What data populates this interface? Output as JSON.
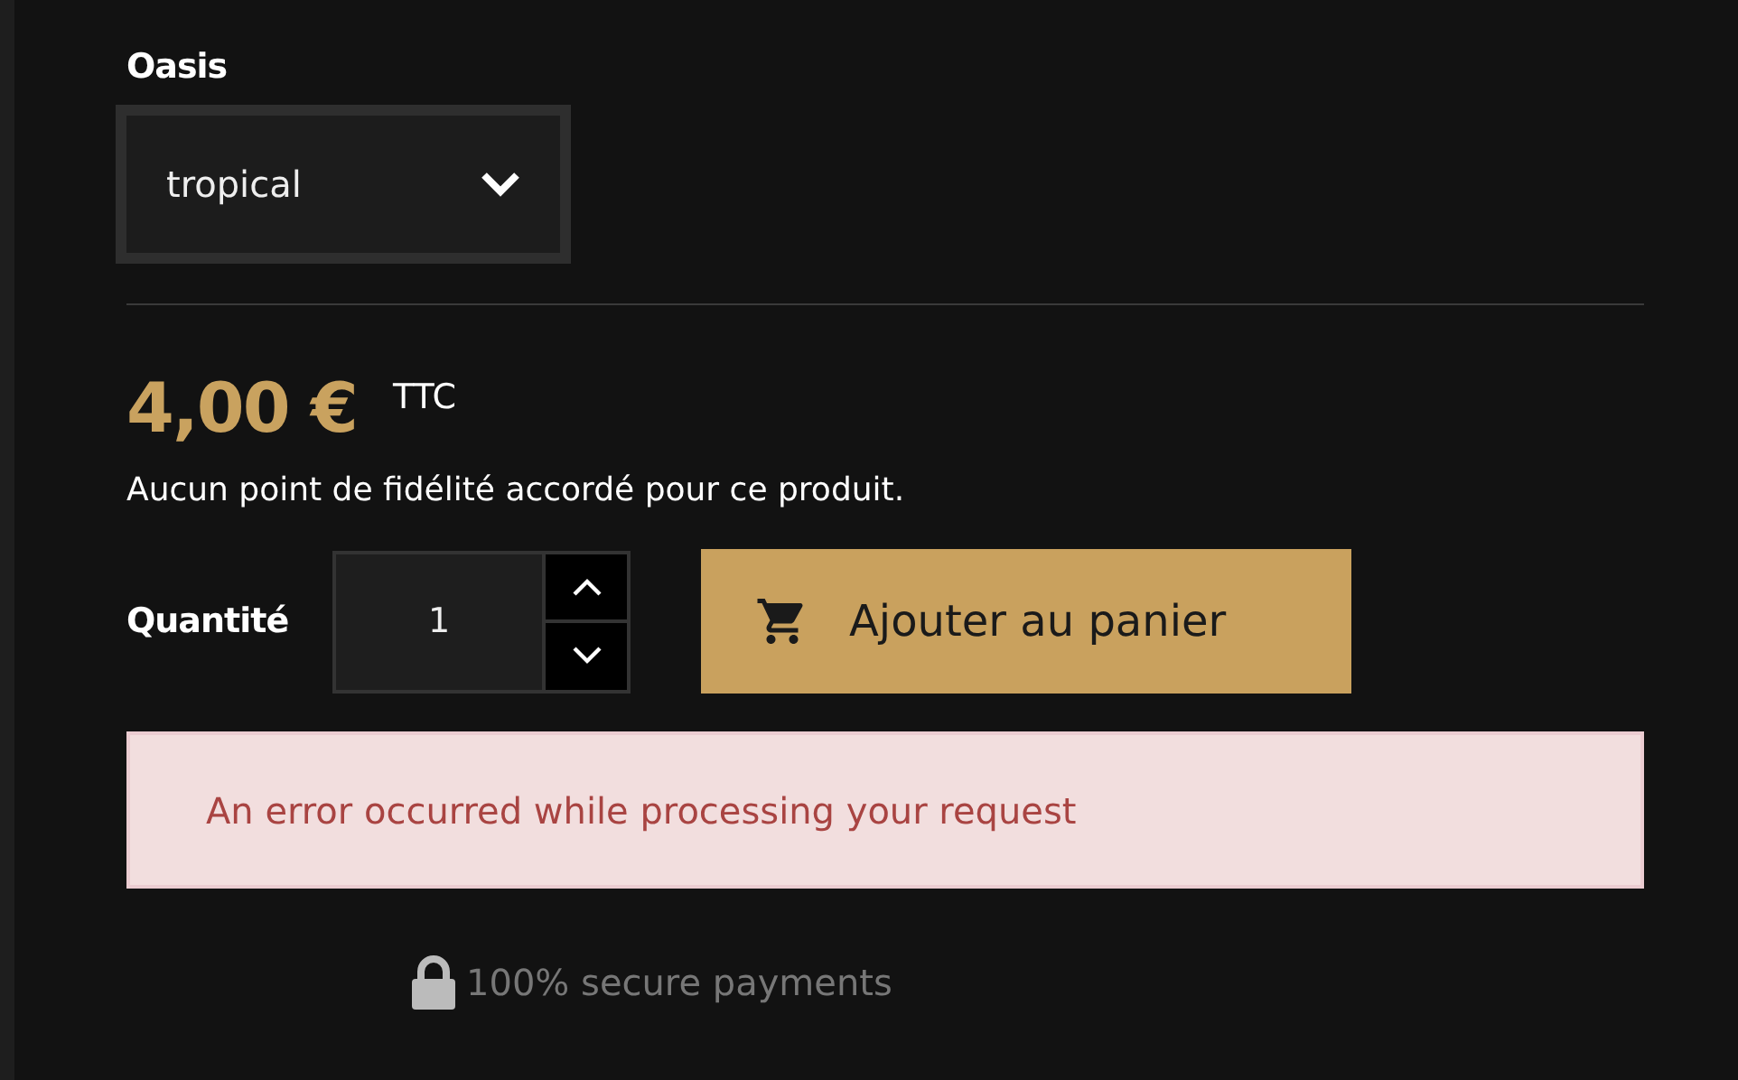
{
  "variant": {
    "label": "Oasis",
    "value": "tropical"
  },
  "price": {
    "amount": "4,00 €",
    "tax_label": "TTC"
  },
  "loyalty_note": "Aucun point de fidélité accordé pour ce produit.",
  "quantity": {
    "label": "Quantité",
    "value": "1"
  },
  "add_to_cart": {
    "label": "Ajouter au panier"
  },
  "alert": {
    "message": "An error occurred while processing your request"
  },
  "secure_note": "100% secure payments"
}
